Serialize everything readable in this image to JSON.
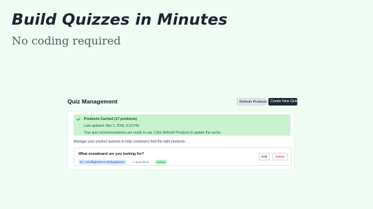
{
  "hero": {
    "title": "Build Quizzes in Minutes",
    "subtitle": "No coding required"
  },
  "header": {
    "title": "Quiz Management",
    "refresh_label": "Refresh Products",
    "new_label": "Create New Quiz"
  },
  "banner": {
    "icon": "check-icon",
    "title": "Products Cached (17 products)",
    "updated": "Last updated: Mar 2, 2026, 9:23 PM",
    "message": "Your quiz recommendations are ready to use. Click Refresh Products to update the cache."
  },
  "intro": "Manage your product quizzes to help customers find the right products.",
  "quizzes": [
    {
      "question": "What snowboard are you looking for?",
      "id": "ID: cmi3ffgb0001n78dhqejl2e02",
      "meta": "· 2 questions",
      "status": "active",
      "edit_label": "Edit",
      "delete_label": "Delete"
    }
  ],
  "colors": {
    "page_bg": "#effcf3",
    "banner_bg": "#c9f2cf",
    "primary_button": "#1f2937",
    "danger": "#b91c1c"
  }
}
